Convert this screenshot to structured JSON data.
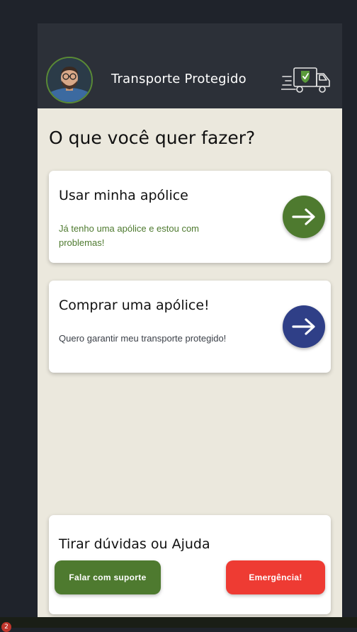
{
  "header": {
    "title": "Transporte Protegido",
    "avatar_icon": "user-avatar",
    "logo_icon": "truck-check-icon"
  },
  "main": {
    "question": "O que você quer fazer?",
    "cards": [
      {
        "title": "Usar minha apólice",
        "subtitle": "Já tenho uma apólice e estou com problemas!",
        "subtitle_color": "#4e7a2f",
        "button_color": "#4e7a2f",
        "icon": "arrow-right-icon"
      },
      {
        "title": "Comprar uma apólice!",
        "subtitle": "Quero garantir meu transporte protegido!",
        "subtitle_color": "#3a3f47",
        "button_color": "#2f3f87",
        "icon": "arrow-right-icon"
      }
    ]
  },
  "help": {
    "title": "Tirar dúvidas ou Ajuda",
    "support_label": "Falar com suporte",
    "support_color": "#4e7a2f",
    "emergency_label": "Emergência!",
    "emergency_color": "#ee3b33"
  },
  "taskbar": {
    "badge_count": "2"
  }
}
